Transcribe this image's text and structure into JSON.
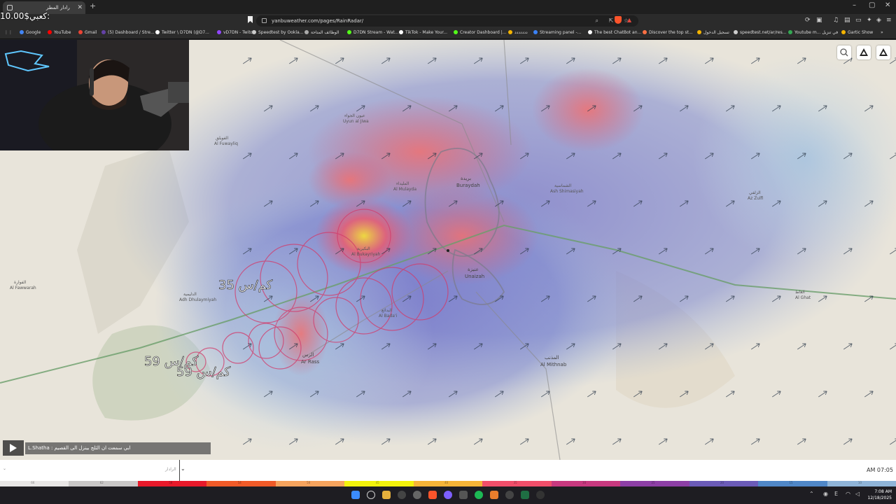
{
  "browser": {
    "tab_title": "رادار المطر",
    "url": "yanbuweather.com/pages/RainRadar/"
  },
  "bookmarks": [
    {
      "label": "Google",
      "color": "#4285f4"
    },
    {
      "label": "YouTube",
      "color": "#ff0000"
    },
    {
      "label": "Gmail",
      "color": "#ea4335"
    },
    {
      "label": "(5) Dashboard / Stre...",
      "color": "#6441a5"
    },
    {
      "label": "Twitter \\ D7DN (@D7...",
      "color": "#ffffff"
    },
    {
      "label": "vD7DN - Twitch",
      "color": "#9146ff"
    },
    {
      "label": "Speedtest by Ookla...",
      "color": "#cccccc"
    },
    {
      "label": "الوظائف المتاحة",
      "color": "#aaaaaa"
    },
    {
      "label": "D7DN Stream - Wat...",
      "color": "#53fc18"
    },
    {
      "label": "TikTok - Make Your...",
      "color": "#ffffff"
    },
    {
      "label": "Creator Dashboard |...",
      "color": "#53fc18"
    },
    {
      "label": "ددددددد",
      "color": "#f4b400"
    },
    {
      "label": "Streaming panel -...",
      "color": "#3b82f6"
    },
    {
      "label": "The best ChatBot an...",
      "color": "#ffffff"
    },
    {
      "label": "Discover the top st...",
      "color": "#ff7043"
    },
    {
      "label": "تسجيل الدخول",
      "color": "#f4b400"
    },
    {
      "label": "speedtest.net/ar/res...",
      "color": "#cccccc"
    },
    {
      "label": "Youtube m... في تنزيل",
      "color": "#34a853"
    },
    {
      "label": "Gartic Show",
      "color": "#f4b400"
    }
  ],
  "stream_overlay": {
    "donation_text": "10.00$كعبي:"
  },
  "map": {
    "cities": [
      {
        "ar": "بريدة",
        "en": "Buraydah"
      },
      {
        "ar": "عنيزة",
        "en": "Unaizah"
      },
      {
        "ar": "الرس",
        "en": "Ar Rass"
      },
      {
        "ar": "المذنب",
        "en": "Al Mithnab"
      },
      {
        "ar": "البكيرية",
        "en": "Al Bukayriyah"
      },
      {
        "ar": "البدائع",
        "en": "Al Bada'i"
      },
      {
        "ar": "الشماسية",
        "en": "Ash Shimasiyah"
      },
      {
        "ar": "الزلفي",
        "en": "Az Zulfi"
      },
      {
        "ar": "الغاط",
        "en": "Al Ghat"
      },
      {
        "ar": "الفوارة",
        "en": "Al Fawwarah"
      },
      {
        "ar": "الدليمية",
        "en": "Adh Dhulaymiyah"
      },
      {
        "ar": "الفويلق",
        "en": "Al Fuwayliq"
      },
      {
        "ar": "المليداء",
        "en": "Al Mulayda"
      },
      {
        "ar": "عيون الجواء",
        "en": "Uyun al Jiwa"
      }
    ],
    "annotations": [
      "35 كم/س",
      "59 كم/س",
      "59 كم/س"
    ]
  },
  "chat": {
    "user": "L.Shatha",
    "message": "ابي سمعت ان الثلج بينزل الى القصيم"
  },
  "timeline": {
    "selector_placeholder": "الرادار",
    "time": "AM 07:05"
  },
  "legend": [
    {
      "value": "66",
      "color": "#e8e6e6"
    },
    {
      "value": "62",
      "color": "#c9c7c7"
    },
    {
      "value": "58",
      "color": "#e8192a"
    },
    {
      "value": "54",
      "color": "#f05a28"
    },
    {
      "value": "50",
      "color": "#f6a35d"
    },
    {
      "value": "45",
      "color": "#f2f20c"
    },
    {
      "value": "40",
      "color": "#f5b437"
    },
    {
      "value": "35",
      "color": "#f04e6a"
    },
    {
      "value": "30",
      "color": "#c8397f"
    },
    {
      "value": "25",
      "color": "#8d3fa6"
    },
    {
      "value": "20",
      "color": "#6b5bb8"
    },
    {
      "value": "15",
      "color": "#4f87c7"
    },
    {
      "value": "10",
      "color": "#8fb4d8"
    }
  ],
  "system": {
    "clock_time": "7:08 AM",
    "clock_date": "12/18/2025"
  }
}
